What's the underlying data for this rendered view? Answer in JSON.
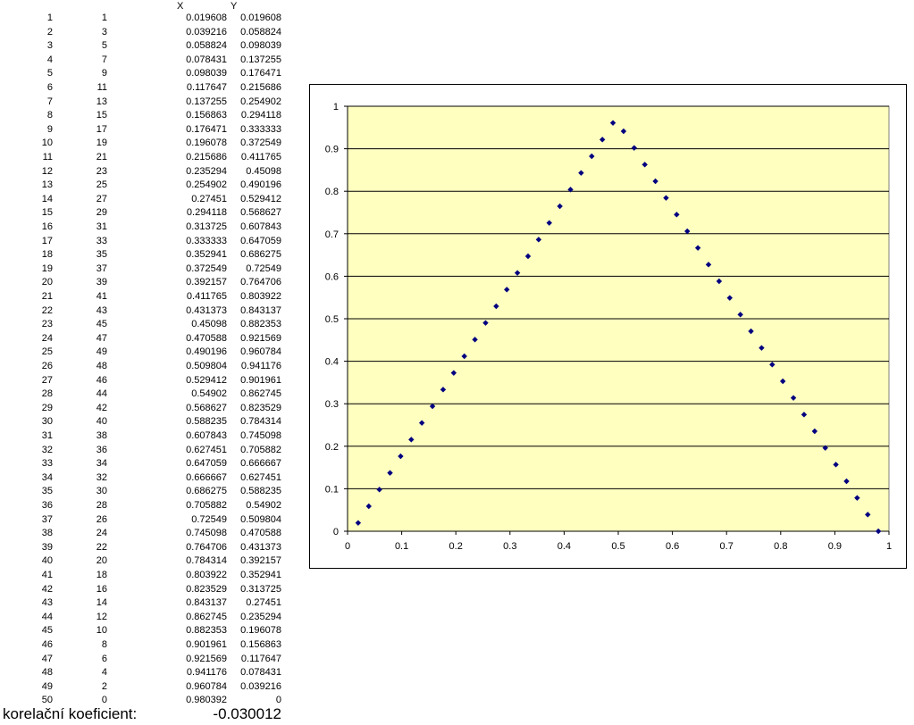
{
  "table": {
    "header_x": "X",
    "header_y": "Y",
    "rows": [
      [
        "1",
        "1",
        "0.019608",
        "0.019608"
      ],
      [
        "2",
        "3",
        "0.039216",
        "0.058824"
      ],
      [
        "3",
        "5",
        "0.058824",
        "0.098039"
      ],
      [
        "4",
        "7",
        "0.078431",
        "0.137255"
      ],
      [
        "5",
        "9",
        "0.098039",
        "0.176471"
      ],
      [
        "6",
        "11",
        "0.117647",
        "0.215686"
      ],
      [
        "7",
        "13",
        "0.137255",
        "0.254902"
      ],
      [
        "8",
        "15",
        "0.156863",
        "0.294118"
      ],
      [
        "9",
        "17",
        "0.176471",
        "0.333333"
      ],
      [
        "10",
        "19",
        "0.196078",
        "0.372549"
      ],
      [
        "11",
        "21",
        "0.215686",
        "0.411765"
      ],
      [
        "12",
        "23",
        "0.235294",
        "0.45098"
      ],
      [
        "13",
        "25",
        "0.254902",
        "0.490196"
      ],
      [
        "14",
        "27",
        "0.27451",
        "0.529412"
      ],
      [
        "15",
        "29",
        "0.294118",
        "0.568627"
      ],
      [
        "16",
        "31",
        "0.313725",
        "0.607843"
      ],
      [
        "17",
        "33",
        "0.333333",
        "0.647059"
      ],
      [
        "18",
        "35",
        "0.352941",
        "0.686275"
      ],
      [
        "19",
        "37",
        "0.372549",
        "0.72549"
      ],
      [
        "20",
        "39",
        "0.392157",
        "0.764706"
      ],
      [
        "21",
        "41",
        "0.411765",
        "0.803922"
      ],
      [
        "22",
        "43",
        "0.431373",
        "0.843137"
      ],
      [
        "23",
        "45",
        "0.45098",
        "0.882353"
      ],
      [
        "24",
        "47",
        "0.470588",
        "0.921569"
      ],
      [
        "25",
        "49",
        "0.490196",
        "0.960784"
      ],
      [
        "26",
        "48",
        "0.509804",
        "0.941176"
      ],
      [
        "27",
        "46",
        "0.529412",
        "0.901961"
      ],
      [
        "28",
        "44",
        "0.54902",
        "0.862745"
      ],
      [
        "29",
        "42",
        "0.568627",
        "0.823529"
      ],
      [
        "30",
        "40",
        "0.588235",
        "0.784314"
      ],
      [
        "31",
        "38",
        "0.607843",
        "0.745098"
      ],
      [
        "32",
        "36",
        "0.627451",
        "0.705882"
      ],
      [
        "33",
        "34",
        "0.647059",
        "0.666667"
      ],
      [
        "34",
        "32",
        "0.666667",
        "0.627451"
      ],
      [
        "35",
        "30",
        "0.686275",
        "0.588235"
      ],
      [
        "36",
        "28",
        "0.705882",
        "0.54902"
      ],
      [
        "37",
        "26",
        "0.72549",
        "0.509804"
      ],
      [
        "38",
        "24",
        "0.745098",
        "0.470588"
      ],
      [
        "39",
        "22",
        "0.764706",
        "0.431373"
      ],
      [
        "40",
        "20",
        "0.784314",
        "0.392157"
      ],
      [
        "41",
        "18",
        "0.803922",
        "0.352941"
      ],
      [
        "42",
        "16",
        "0.823529",
        "0.313725"
      ],
      [
        "43",
        "14",
        "0.843137",
        "0.27451"
      ],
      [
        "44",
        "12",
        "0.862745",
        "0.235294"
      ],
      [
        "45",
        "10",
        "0.882353",
        "0.196078"
      ],
      [
        "46",
        "8",
        "0.901961",
        "0.156863"
      ],
      [
        "47",
        "6",
        "0.921569",
        "0.117647"
      ],
      [
        "48",
        "4",
        "0.941176",
        "0.078431"
      ],
      [
        "49",
        "2",
        "0.960784",
        "0.039216"
      ],
      [
        "50",
        "0",
        "0.980392",
        "0"
      ]
    ]
  },
  "correlation": {
    "label": "korelační koeficient:",
    "value": "-0.030012"
  },
  "chart_data": {
    "type": "scatter",
    "title": "",
    "xlabel": "",
    "ylabel": "",
    "xlim": [
      0,
      1
    ],
    "ylim": [
      0,
      1
    ],
    "x_ticks": [
      "0",
      "0.1",
      "0.2",
      "0.3",
      "0.4",
      "0.5",
      "0.6",
      "0.7",
      "0.8",
      "0.9",
      "1"
    ],
    "y_ticks": [
      "0",
      "0.1",
      "0.2",
      "0.3",
      "0.4",
      "0.5",
      "0.6",
      "0.7",
      "0.8",
      "0.9",
      "1"
    ],
    "grid": "horizontal",
    "legend": "none",
    "plot_background": "#ffffc0",
    "marker_color": "#000080",
    "x": [
      0.019608,
      0.039216,
      0.058824,
      0.078431,
      0.098039,
      0.117647,
      0.137255,
      0.156863,
      0.176471,
      0.196078,
      0.215686,
      0.235294,
      0.254902,
      0.27451,
      0.294118,
      0.313725,
      0.333333,
      0.352941,
      0.372549,
      0.392157,
      0.411765,
      0.431373,
      0.45098,
      0.470588,
      0.490196,
      0.509804,
      0.529412,
      0.54902,
      0.568627,
      0.588235,
      0.607843,
      0.627451,
      0.647059,
      0.666667,
      0.686275,
      0.705882,
      0.72549,
      0.745098,
      0.764706,
      0.784314,
      0.803922,
      0.823529,
      0.843137,
      0.862745,
      0.882353,
      0.901961,
      0.921569,
      0.941176,
      0.960784,
      0.980392
    ],
    "y": [
      0.019608,
      0.058824,
      0.098039,
      0.137255,
      0.176471,
      0.215686,
      0.254902,
      0.294118,
      0.333333,
      0.372549,
      0.411765,
      0.45098,
      0.490196,
      0.529412,
      0.568627,
      0.607843,
      0.647059,
      0.686275,
      0.72549,
      0.764706,
      0.803922,
      0.843137,
      0.882353,
      0.921569,
      0.960784,
      0.941176,
      0.901961,
      0.862745,
      0.823529,
      0.784314,
      0.745098,
      0.705882,
      0.666667,
      0.627451,
      0.588235,
      0.54902,
      0.509804,
      0.470588,
      0.431373,
      0.392157,
      0.352941,
      0.313725,
      0.27451,
      0.235294,
      0.196078,
      0.156863,
      0.117647,
      0.078431,
      0.039216,
      0
    ]
  }
}
